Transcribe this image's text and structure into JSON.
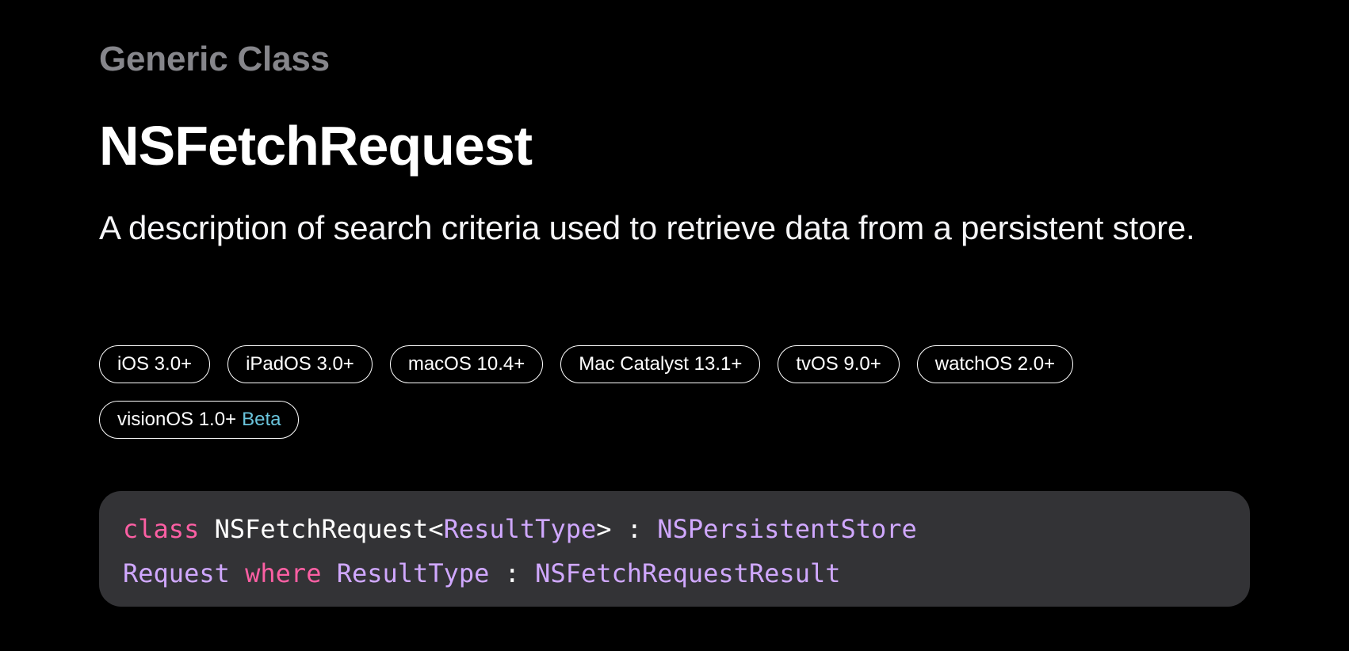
{
  "header": {
    "eyebrow": "Generic Class",
    "title": "NSFetchRequest",
    "abstract": "A description of search criteria used to retrieve data from a persistent store."
  },
  "platforms": [
    {
      "label": "iOS 3.0+",
      "badge": ""
    },
    {
      "label": "iPadOS 3.0+",
      "badge": ""
    },
    {
      "label": "macOS 10.4+",
      "badge": ""
    },
    {
      "label": "Mac Catalyst 13.1+",
      "badge": ""
    },
    {
      "label": "tvOS 9.0+",
      "badge": ""
    },
    {
      "label": "watchOS 2.0+",
      "badge": ""
    },
    {
      "label": "visionOS 1.0+",
      "badge": "Beta"
    }
  ],
  "declaration": {
    "line1": {
      "keyword": "class",
      "name": " NSFetchRequest<",
      "generic": "ResultType",
      "close": "> : ",
      "superclass": "NSPersistentStore"
    },
    "line2": {
      "superclass_cont": "Request",
      "where": "where",
      "constraint_type": "ResultType",
      "colon": " : ",
      "protocol": "NSFetchRequestResult"
    }
  },
  "colors": {
    "background": "#000000",
    "eyebrow": "#86868b",
    "beta_accent": "#6ac4dc",
    "code_background": "#333336",
    "code_keyword": "#fc5fa3",
    "code_type": "#d0a8ff"
  }
}
